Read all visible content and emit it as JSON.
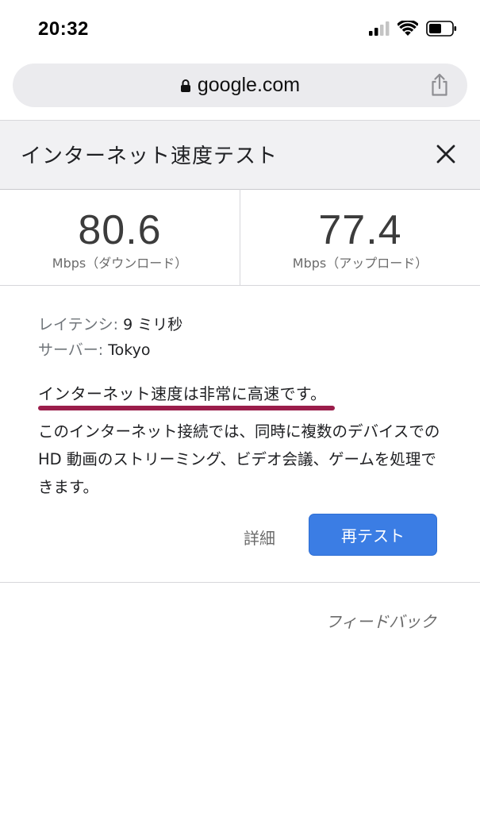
{
  "status_bar": {
    "time": "20:32",
    "icons": [
      "cellular-signal-icon",
      "wifi-icon",
      "battery-icon"
    ]
  },
  "browser": {
    "url": "google.com",
    "icons": [
      "lock-icon",
      "share-icon"
    ]
  },
  "speed_test": {
    "title": "インターネット速度テスト",
    "download": {
      "value": "80.6",
      "label": "Mbps（ダウンロード）"
    },
    "upload": {
      "value": "77.4",
      "label": "Mbps（アップロード）"
    },
    "latency": {
      "key": "レイテンシ:",
      "value": "9 ミリ秒"
    },
    "server": {
      "key": "サーバー:",
      "value": "Tokyo"
    },
    "headline": "インターネット速度は非常に高速です。",
    "description": "このインターネット接続では、同時に複数のデバイスでの HD 動画のストリーミング、ビデオ会議、ゲームを処理できます。",
    "details_label": "詳細",
    "retest_label": "再テスト",
    "feedback_label": "フィードバック"
  },
  "colors": {
    "accent_blue": "#3b7de4",
    "speed_bar": "#9b1d4b",
    "header_bg": "#f1f1f3"
  }
}
